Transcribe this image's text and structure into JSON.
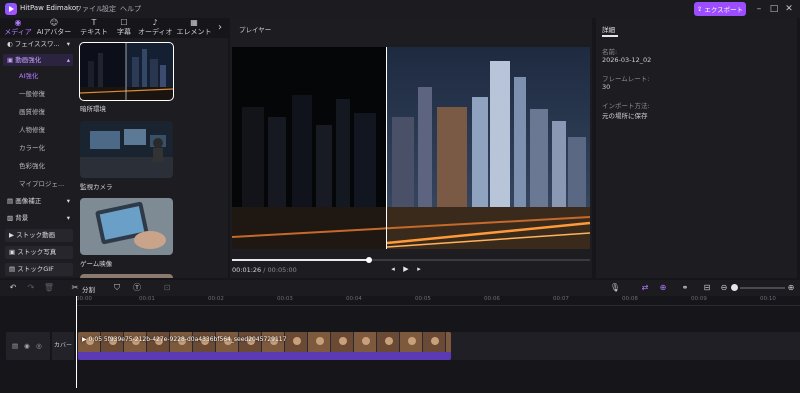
{
  "app": {
    "title": "HitPaw Edimakor"
  },
  "menu": [
    "ファイル",
    "設定",
    "ヘルプ"
  ],
  "export_label": "エクスポート",
  "main_tabs": [
    {
      "icon": "media-icon",
      "label": "メディア",
      "active": true
    },
    {
      "icon": "ai-avatar-icon",
      "label": "AIアバター"
    },
    {
      "icon": "text-icon",
      "label": "テキスト"
    },
    {
      "icon": "caption-icon",
      "label": "字幕"
    },
    {
      "icon": "audio-icon",
      "label": "オーディオ"
    },
    {
      "icon": "element-icon",
      "label": "エレメント"
    }
  ],
  "sidebar": {
    "categories": [
      {
        "label": "フェイススワ..."
      },
      {
        "label": "動画強化",
        "selected": true
      },
      {
        "label": "画像補正"
      },
      {
        "label": "背景"
      }
    ],
    "sub_items": [
      "AI強化",
      "一般修復",
      "画質修復",
      "人物修復",
      "カラー化",
      "色彩強化",
      "マイプロジェ..."
    ],
    "buttons": [
      "ストック動画",
      "ストック写真",
      "ストックGIF"
    ]
  },
  "assets": [
    {
      "label": "暗所環境",
      "selected": true
    },
    {
      "label": "監視カメラ"
    },
    {
      "label": "ゲーム映像"
    }
  ],
  "player": {
    "title": "プレイヤー",
    "current_time": "00:01:26",
    "duration": "00:05:00",
    "progress_fraction": 0.382
  },
  "properties": {
    "tab": "詳細",
    "fields": [
      {
        "label": "名前:",
        "value": "2026-03-12_02"
      },
      {
        "label": "フレームレート:",
        "value": "30"
      },
      {
        "label": "インポート方法:",
        "value": "元の場所に保存"
      }
    ]
  },
  "timeline": {
    "split_label": "分割",
    "ruler": [
      "00:00",
      "00:01",
      "00:02",
      "00:03",
      "00:04",
      "00:05",
      "00:06",
      "00:07",
      "00:08",
      "00:09",
      "00:10"
    ],
    "track_label": "カバー",
    "clip_name": "0:05 5f939e75-212b-427e-9228-d0a4336bf564_seed2045729117"
  }
}
